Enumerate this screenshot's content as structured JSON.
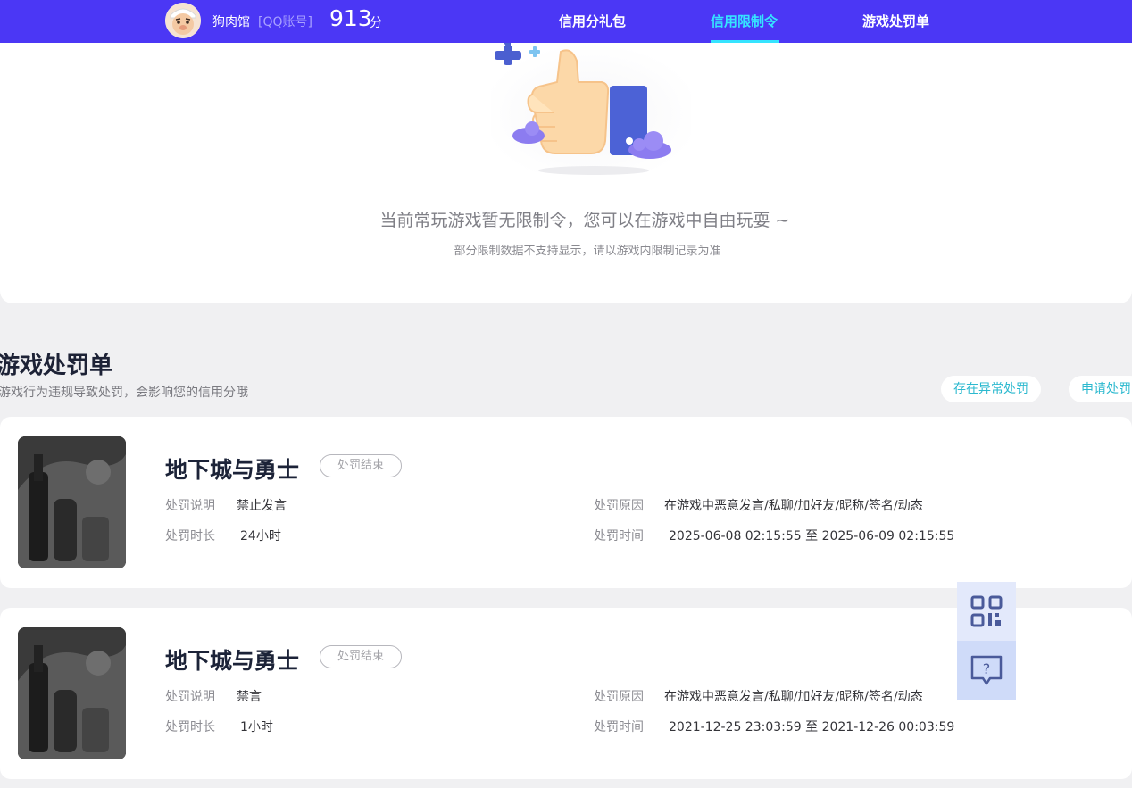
{
  "header": {
    "nickname": "狗肉馆",
    "account_tag": "[QQ账号]",
    "score": "913",
    "score_unit": "分",
    "nav": [
      "信用分礼包",
      "信用限制令",
      "游戏处罚单"
    ],
    "active_nav": "信用限制令",
    "colors": {
      "bar": "#4b37f5",
      "active": "#35e4ff"
    }
  },
  "restriction_status": {
    "message": "当前常玩游戏暂无限制令，您可以在游戏中自由玩耍 ~",
    "note": "部分限制数据不支持显示，请以游戏内限制记录为准",
    "icon": "thumbs-up-illustration"
  },
  "penalty_section": {
    "title": "游戏处罚单",
    "subtitle": "游戏行为违规导致处罚，会影响您的信用分哦",
    "buttons": [
      "存在异常处罚",
      "申请处罚"
    ]
  },
  "labels": {
    "description": "处罚说明",
    "duration": "处罚时长",
    "reason": "处罚原因",
    "time": "处罚时间"
  },
  "penalties": [
    {
      "game": "地下城与勇士",
      "status": "处罚结束",
      "description": "禁止发言",
      "duration": "24小时",
      "reason": "在游戏中恶意发言/私聊/加好友/昵称/签名/动态",
      "time": "2025-06-08 02:15:55 至 2025-06-09 02:15:55"
    },
    {
      "game": "地下城与勇士",
      "status": "处罚结束",
      "description": "禁言",
      "duration": "1小时",
      "reason": "在游戏中恶意发言/私聊/加好友/昵称/签名/动态",
      "time": "2021-12-25 23:03:59 至 2021-12-26 00:03:59"
    }
  ],
  "floating": {
    "icons": [
      "qr-code-icon",
      "help-chat-icon"
    ]
  }
}
